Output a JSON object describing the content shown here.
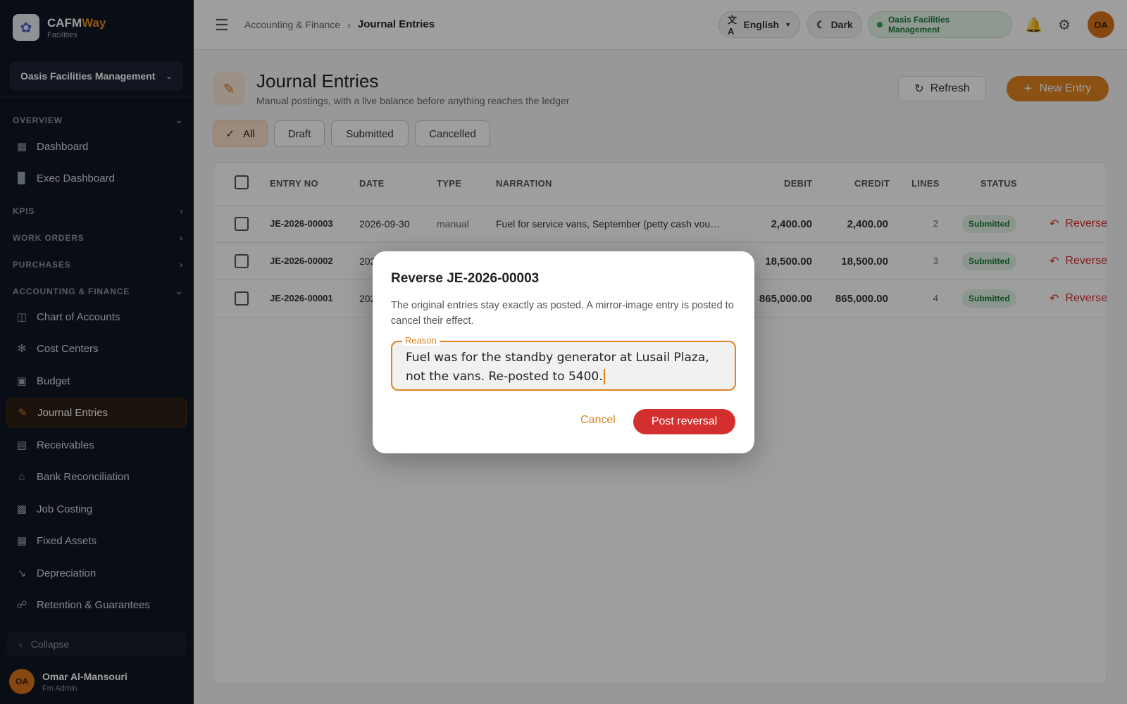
{
  "brand": {
    "name_a": "CAFM",
    "name_b": "Way",
    "subtitle": "Facilities"
  },
  "org_selector": {
    "value": "Oasis Facilities Management"
  },
  "sidebar": {
    "sections": [
      {
        "label": "OVERVIEW"
      },
      {
        "label": "KPIS"
      },
      {
        "label": "WORK ORDERS"
      },
      {
        "label": "PURCHASES"
      },
      {
        "label": "ACCOUNTING & FINANCE"
      }
    ],
    "overview_items": [
      {
        "label": "Dashboard"
      },
      {
        "label": "Exec Dashboard"
      }
    ],
    "finance_items": [
      {
        "label": "Chart of Accounts"
      },
      {
        "label": "Cost Centers"
      },
      {
        "label": "Budget"
      },
      {
        "label": "Journal Entries"
      },
      {
        "label": "Receivables"
      },
      {
        "label": "Bank Reconciliation"
      },
      {
        "label": "Job Costing"
      },
      {
        "label": "Fixed Assets"
      },
      {
        "label": "Depreciation"
      },
      {
        "label": "Retention & Guarantees"
      }
    ],
    "collapse_label": "Collapse",
    "user": {
      "initials": "OA",
      "name": "Omar Al-Mansouri",
      "role": "Fm Admin"
    }
  },
  "topbar": {
    "breadcrumb_parent": "Accounting & Finance",
    "breadcrumb_current": "Journal Entries",
    "language": "English",
    "theme": "Dark",
    "org_badge": "Oasis Facilities Management",
    "avatar_initials": "OA"
  },
  "page": {
    "title": "Journal Entries",
    "subtitle": "Manual postings, with a live balance before anything reaches the ledger",
    "refresh_label": "Refresh",
    "new_entry_label": "New Entry",
    "filters": [
      "All",
      "Draft",
      "Submitted",
      "Cancelled"
    ],
    "active_filter": "All"
  },
  "table": {
    "headers": {
      "entry_no": "ENTRY NO",
      "date": "DATE",
      "type": "TYPE",
      "narration": "NARRATION",
      "debit": "DEBIT",
      "credit": "CREDIT",
      "lines": "LINES",
      "status": "STATUS"
    },
    "rows": [
      {
        "entry_no": "JE-2026-00003",
        "date": "2026-09-30",
        "type": "manual",
        "narration": "Fuel for service vans, September (petty cash vou…",
        "debit": "2,400.00",
        "credit": "2,400.00",
        "lines": "2",
        "status": "Submitted",
        "action": "Reverse"
      },
      {
        "entry_no": "JE-2026-00002",
        "date": "202",
        "type": "",
        "narration": "",
        "debit": "18,500.00",
        "credit": "18,500.00",
        "lines": "3",
        "status": "Submitted",
        "action": "Reverse"
      },
      {
        "entry_no": "JE-2026-00001",
        "date": "202",
        "type": "",
        "narration": "",
        "debit": "865,000.00",
        "credit": "865,000.00",
        "lines": "4",
        "status": "Submitted",
        "action": "Reverse"
      }
    ]
  },
  "modal": {
    "title": "Reverse JE-2026-00003",
    "body": "The original entries stay exactly as posted. A mirror-image entry is posted to cancel their effect.",
    "field_label": "Reason",
    "field_value": "Fuel was for the standby generator at Lusail Plaza, not the vans. Re-posted to 5400.",
    "cancel_label": "Cancel",
    "confirm_label": "Post reversal"
  },
  "colors": {
    "accent": "#e0831f",
    "danger": "#d32f2f",
    "success": "#1e7a3a",
    "sidebar_bg": "#0f1623"
  }
}
